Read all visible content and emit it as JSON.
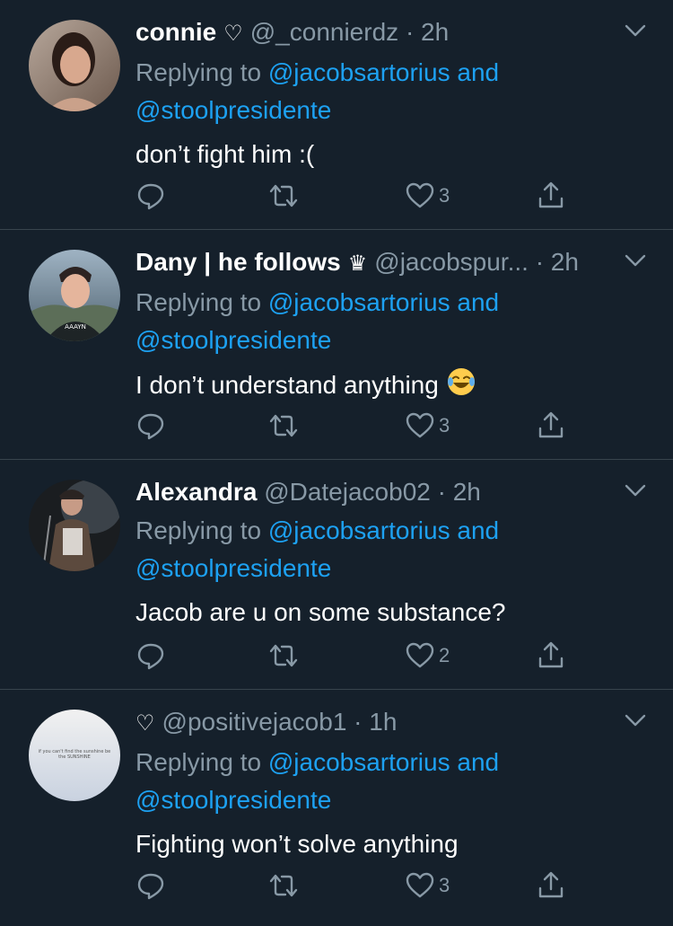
{
  "tweets": [
    {
      "name": "connie",
      "badge": "♡",
      "handle": "@_connierdz",
      "dot": "·",
      "time": "2h",
      "replying_prefix": "Replying to",
      "reply_user_1": "@jacobsartorius",
      "reply_and": "and",
      "reply_user_2": "@stoolpresidente",
      "text": "don’t fight him :(",
      "likes": "3"
    },
    {
      "name": "Dany | he follows",
      "badge": "♛",
      "handle": "@jacobspur...",
      "dot": "·",
      "time": "2h",
      "replying_prefix": "Replying to",
      "reply_user_1": "@jacobsartorius",
      "reply_and": "and",
      "reply_user_2": "@stoolpresidente",
      "text": "I don’t understand anything",
      "emoji": "tears-of-joy-emoji",
      "likes": "3"
    },
    {
      "name": "Alexandra",
      "badge": "",
      "handle": "@Datejacob02",
      "dot": "·",
      "time": "2h",
      "replying_prefix": "Replying to",
      "reply_user_1": "@jacobsartorius",
      "reply_and": "and",
      "reply_user_2": "@stoolpresidente",
      "text": "Jacob are u on some substance?",
      "likes": "2"
    },
    {
      "name": "",
      "badge": "♡",
      "handle": "@positivejacob1",
      "dot": "·",
      "time": "1h",
      "replying_prefix": "Replying to",
      "reply_user_1": "@jacobsartorius",
      "reply_and": "and",
      "reply_user_2": "@stoolpresidente",
      "text": "Fighting won’t solve anything",
      "avatar_text": "if you can't find the sunshine be the SUNSHINE",
      "likes": "3"
    }
  ],
  "icons": {
    "reply": "reply-icon",
    "retweet": "retweet-icon",
    "like": "heart-icon",
    "share": "share-icon",
    "menu": "chevron-down-icon"
  },
  "colors": {
    "background": "#15202b",
    "secondary_text": "#8899a6",
    "link": "#1da1f2",
    "divider": "#38444d"
  }
}
